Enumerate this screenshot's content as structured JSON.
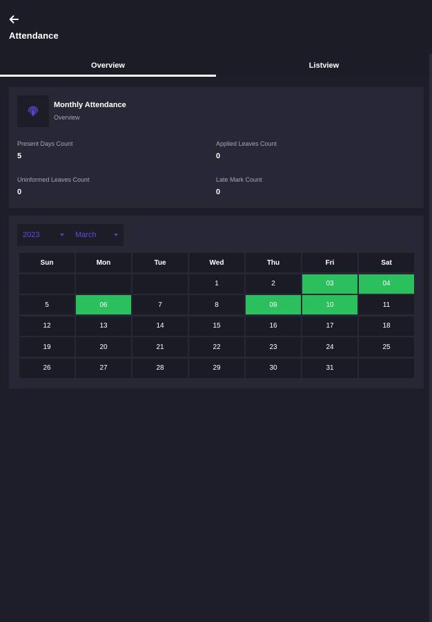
{
  "appbar": {
    "title": "Attendance",
    "back_icon": "arrow-left-icon"
  },
  "tabs": [
    {
      "label": "Overview",
      "active": true
    },
    {
      "label": "Listview",
      "active": false
    }
  ],
  "summary": {
    "icon": "fingerprint-icon",
    "title": "Monthly Attendance",
    "subtitle": "Overview",
    "stats": [
      {
        "label": "Present Days Count",
        "value": "5"
      },
      {
        "label": "Applied Leaves Count",
        "value": "0"
      },
      {
        "label": "Uninformed Leaves Count",
        "value": "0"
      },
      {
        "label": "Late Mark Count",
        "value": "0"
      }
    ]
  },
  "calendar": {
    "year": "2023",
    "month": "March",
    "accent_color": "#5b4ee6",
    "present_color": "#2bbf5e",
    "weekdays": [
      "Sun",
      "Mon",
      "Tue",
      "Wed",
      "Thu",
      "Fri",
      "Sat"
    ],
    "weeks": [
      [
        "",
        "",
        "",
        "1",
        "2",
        "03",
        "04"
      ],
      [
        "5",
        "06",
        "7",
        "8",
        "09",
        "10",
        "11"
      ],
      [
        "12",
        "13",
        "14",
        "15",
        "16",
        "17",
        "18"
      ],
      [
        "19",
        "20",
        "21",
        "22",
        "23",
        "24",
        "25"
      ],
      [
        "26",
        "27",
        "28",
        "29",
        "30",
        "31",
        ""
      ]
    ],
    "present_days": [
      "03",
      "04",
      "06",
      "09",
      "10"
    ]
  }
}
